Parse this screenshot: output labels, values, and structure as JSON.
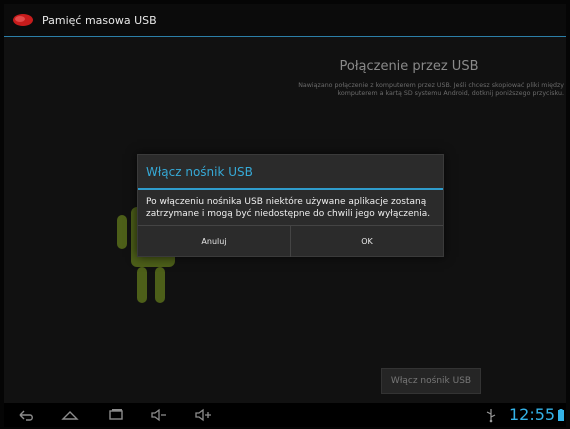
{
  "status_bar": {
    "app_title": "Pamięć masowa USB"
  },
  "main": {
    "usb_title": "Połączenie przez USB",
    "usb_description": "Nawiązano połączenie z komputerem przez USB. Jeśli chcesz skopiować pliki między komputerem a kartą SD systemu Android, dotknij poniższego przycisku.",
    "usb_enable_label": "Włącz nośnik USB"
  },
  "dialog": {
    "title": "Włącz nośnik USB",
    "message": "Po włączeniu nośnika USB niektóre używane aplikacje zostaną zatrzymane i mogą być niedostępne do chwili jego wyłączenia.",
    "cancel_label": "Anuluj",
    "ok_label": "OK"
  },
  "navbar": {
    "time": "12:55",
    "icons": [
      "back-icon",
      "home-icon",
      "recent-apps-icon",
      "volume-down-icon",
      "volume-up-icon",
      "usb-icon",
      "battery-icon"
    ]
  },
  "colors": {
    "accent": "#34b3e8",
    "dialog_title": "#36a9d6",
    "android_green": "#4d5f19"
  }
}
